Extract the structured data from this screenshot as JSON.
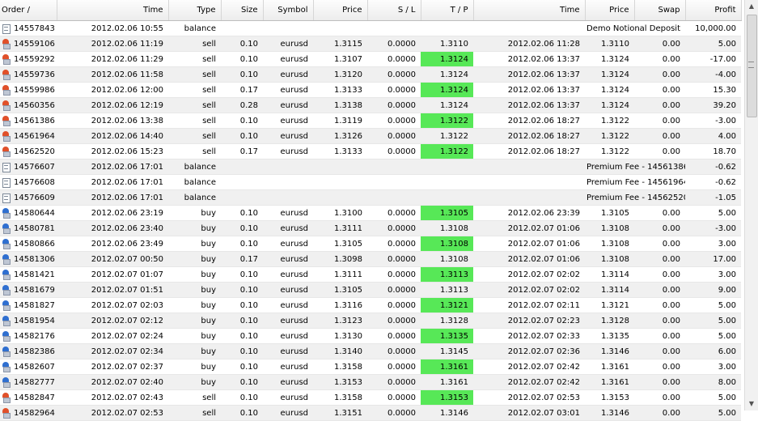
{
  "columns": [
    {
      "key": "order",
      "label": "Order  /",
      "align": "l",
      "w": 70
    },
    {
      "key": "time",
      "label": "Time",
      "align": "r",
      "w": 138
    },
    {
      "key": "type",
      "label": "Type",
      "align": "r",
      "w": 65
    },
    {
      "key": "size",
      "label": "Size",
      "align": "r",
      "w": 52
    },
    {
      "key": "symbol",
      "label": "Symbol",
      "align": "r",
      "w": 62
    },
    {
      "key": "price",
      "label": "Price",
      "align": "r",
      "w": 67
    },
    {
      "key": "sl",
      "label": "S / L",
      "align": "r",
      "w": 66
    },
    {
      "key": "tp",
      "label": "T / P",
      "align": "r",
      "w": 65
    },
    {
      "key": "ctime",
      "label": "Time",
      "align": "r",
      "w": 138
    },
    {
      "key": "cprice",
      "label": "Price",
      "align": "r",
      "w": 61
    },
    {
      "key": "swap",
      "label": "Swap",
      "align": "r",
      "w": 63
    },
    {
      "key": "profit",
      "label": "Profit",
      "align": "r",
      "w": 69
    }
  ],
  "rows": [
    {
      "icon": "balance",
      "order": "14557843",
      "time": "2012.02.06 10:55",
      "type": "balance",
      "note": "Demo Notional Deposit",
      "profit": "10,000.00"
    },
    {
      "icon": "sell",
      "order": "14559106",
      "time": "2012.02.06 11:19",
      "type": "sell",
      "size": "0.10",
      "symbol": "eurusd",
      "price": "1.3115",
      "sl": "0.0000",
      "tp": "1.3110",
      "ctime": "2012.02.06 11:28",
      "cprice": "1.3110",
      "swap": "0.00",
      "profit": "5.00"
    },
    {
      "icon": "sell",
      "order": "14559292",
      "time": "2012.02.06 11:29",
      "type": "sell",
      "size": "0.10",
      "symbol": "eurusd",
      "price": "1.3107",
      "sl": "0.0000",
      "tp": "1.3124",
      "ctime": "2012.02.06 13:37",
      "cprice": "1.3124",
      "swap": "0.00",
      "profit": "-17.00"
    },
    {
      "icon": "sell",
      "order": "14559736",
      "time": "2012.02.06 11:58",
      "type": "sell",
      "size": "0.10",
      "symbol": "eurusd",
      "price": "1.3120",
      "sl": "0.0000",
      "tp": "1.3124",
      "ctime": "2012.02.06 13:37",
      "cprice": "1.3124",
      "swap": "0.00",
      "profit": "-4.00"
    },
    {
      "icon": "sell",
      "order": "14559986",
      "time": "2012.02.06 12:00",
      "type": "sell",
      "size": "0.17",
      "symbol": "eurusd",
      "price": "1.3133",
      "sl": "0.0000",
      "tp": "1.3124",
      "ctime": "2012.02.06 13:37",
      "cprice": "1.3124",
      "swap": "0.00",
      "profit": "15.30"
    },
    {
      "icon": "sell",
      "order": "14560356",
      "time": "2012.02.06 12:19",
      "type": "sell",
      "size": "0.28",
      "symbol": "eurusd",
      "price": "1.3138",
      "sl": "0.0000",
      "tp": "1.3124",
      "ctime": "2012.02.06 13:37",
      "cprice": "1.3124",
      "swap": "0.00",
      "profit": "39.20"
    },
    {
      "icon": "sell",
      "order": "14561386",
      "time": "2012.02.06 13:38",
      "type": "sell",
      "size": "0.10",
      "symbol": "eurusd",
      "price": "1.3119",
      "sl": "0.0000",
      "tp": "1.3122",
      "ctime": "2012.02.06 18:27",
      "cprice": "1.3122",
      "swap": "0.00",
      "profit": "-3.00"
    },
    {
      "icon": "sell",
      "order": "14561964",
      "time": "2012.02.06 14:40",
      "type": "sell",
      "size": "0.10",
      "symbol": "eurusd",
      "price": "1.3126",
      "sl": "0.0000",
      "tp": "1.3122",
      "ctime": "2012.02.06 18:27",
      "cprice": "1.3122",
      "swap": "0.00",
      "profit": "4.00"
    },
    {
      "icon": "sell",
      "order": "14562520",
      "time": "2012.02.06 15:23",
      "type": "sell",
      "size": "0.17",
      "symbol": "eurusd",
      "price": "1.3133",
      "sl": "0.0000",
      "tp": "1.3122",
      "ctime": "2012.02.06 18:27",
      "cprice": "1.3122",
      "swap": "0.00",
      "profit": "18.70"
    },
    {
      "icon": "balance",
      "order": "14576607",
      "time": "2012.02.06 17:01",
      "type": "balance",
      "note": "Premium Fee - 14561386",
      "profit": "-0.62"
    },
    {
      "icon": "balance",
      "order": "14576608",
      "time": "2012.02.06 17:01",
      "type": "balance",
      "note": "Premium Fee - 14561964",
      "profit": "-0.62"
    },
    {
      "icon": "balance",
      "order": "14576609",
      "time": "2012.02.06 17:01",
      "type": "balance",
      "note": "Premium Fee - 14562520",
      "profit": "-1.05"
    },
    {
      "icon": "buy",
      "order": "14580644",
      "time": "2012.02.06 23:19",
      "type": "buy",
      "size": "0.10",
      "symbol": "eurusd",
      "price": "1.3100",
      "sl": "0.0000",
      "tp": "1.3105",
      "ctime": "2012.02.06 23:39",
      "cprice": "1.3105",
      "swap": "0.00",
      "profit": "5.00"
    },
    {
      "icon": "buy",
      "order": "14580781",
      "time": "2012.02.06 23:40",
      "type": "buy",
      "size": "0.10",
      "symbol": "eurusd",
      "price": "1.3111",
      "sl": "0.0000",
      "tp": "1.3108",
      "ctime": "2012.02.07 01:06",
      "cprice": "1.3108",
      "swap": "0.00",
      "profit": "-3.00"
    },
    {
      "icon": "buy",
      "order": "14580866",
      "time": "2012.02.06 23:49",
      "type": "buy",
      "size": "0.10",
      "symbol": "eurusd",
      "price": "1.3105",
      "sl": "0.0000",
      "tp": "1.3108",
      "ctime": "2012.02.07 01:06",
      "cprice": "1.3108",
      "swap": "0.00",
      "profit": "3.00"
    },
    {
      "icon": "buy",
      "order": "14581306",
      "time": "2012.02.07 00:50",
      "type": "buy",
      "size": "0.17",
      "symbol": "eurusd",
      "price": "1.3098",
      "sl": "0.0000",
      "tp": "1.3108",
      "ctime": "2012.02.07 01:06",
      "cprice": "1.3108",
      "swap": "0.00",
      "profit": "17.00"
    },
    {
      "icon": "buy",
      "order": "14581421",
      "time": "2012.02.07 01:07",
      "type": "buy",
      "size": "0.10",
      "symbol": "eurusd",
      "price": "1.3111",
      "sl": "0.0000",
      "tp": "1.3113",
      "ctime": "2012.02.07 02:02",
      "cprice": "1.3114",
      "swap": "0.00",
      "profit": "3.00"
    },
    {
      "icon": "buy",
      "order": "14581679",
      "time": "2012.02.07 01:51",
      "type": "buy",
      "size": "0.10",
      "symbol": "eurusd",
      "price": "1.3105",
      "sl": "0.0000",
      "tp": "1.3113",
      "ctime": "2012.02.07 02:02",
      "cprice": "1.3114",
      "swap": "0.00",
      "profit": "9.00"
    },
    {
      "icon": "buy",
      "order": "14581827",
      "time": "2012.02.07 02:03",
      "type": "buy",
      "size": "0.10",
      "symbol": "eurusd",
      "price": "1.3116",
      "sl": "0.0000",
      "tp": "1.3121",
      "ctime": "2012.02.07 02:11",
      "cprice": "1.3121",
      "swap": "0.00",
      "profit": "5.00"
    },
    {
      "icon": "buy",
      "order": "14581954",
      "time": "2012.02.07 02:12",
      "type": "buy",
      "size": "0.10",
      "symbol": "eurusd",
      "price": "1.3123",
      "sl": "0.0000",
      "tp": "1.3128",
      "ctime": "2012.02.07 02:23",
      "cprice": "1.3128",
      "swap": "0.00",
      "profit": "5.00"
    },
    {
      "icon": "buy",
      "order": "14582176",
      "time": "2012.02.07 02:24",
      "type": "buy",
      "size": "0.10",
      "symbol": "eurusd",
      "price": "1.3130",
      "sl": "0.0000",
      "tp": "1.3135",
      "ctime": "2012.02.07 02:33",
      "cprice": "1.3135",
      "swap": "0.00",
      "profit": "5.00"
    },
    {
      "icon": "buy",
      "order": "14582386",
      "time": "2012.02.07 02:34",
      "type": "buy",
      "size": "0.10",
      "symbol": "eurusd",
      "price": "1.3140",
      "sl": "0.0000",
      "tp": "1.3145",
      "ctime": "2012.02.07 02:36",
      "cprice": "1.3146",
      "swap": "0.00",
      "profit": "6.00"
    },
    {
      "icon": "buy",
      "order": "14582607",
      "time": "2012.02.07 02:37",
      "type": "buy",
      "size": "0.10",
      "symbol": "eurusd",
      "price": "1.3158",
      "sl": "0.0000",
      "tp": "1.3161",
      "ctime": "2012.02.07 02:42",
      "cprice": "1.3161",
      "swap": "0.00",
      "profit": "3.00"
    },
    {
      "icon": "buy",
      "order": "14582777",
      "time": "2012.02.07 02:40",
      "type": "buy",
      "size": "0.10",
      "symbol": "eurusd",
      "price": "1.3153",
      "sl": "0.0000",
      "tp": "1.3161",
      "ctime": "2012.02.07 02:42",
      "cprice": "1.3161",
      "swap": "0.00",
      "profit": "8.00"
    },
    {
      "icon": "sell",
      "order": "14582847",
      "time": "2012.02.07 02:43",
      "type": "sell",
      "size": "0.10",
      "symbol": "eurusd",
      "price": "1.3158",
      "sl": "0.0000",
      "tp": "1.3153",
      "ctime": "2012.02.07 02:53",
      "cprice": "1.3153",
      "swap": "0.00",
      "profit": "5.00"
    },
    {
      "icon": "sell",
      "order": "14582964",
      "time": "2012.02.07 02:53",
      "type": "sell",
      "size": "0.10",
      "symbol": "eurusd",
      "price": "1.3151",
      "sl": "0.0000",
      "tp": "1.3146",
      "ctime": "2012.02.07 03:01",
      "cprice": "1.3146",
      "swap": "0.00",
      "profit": "5.00"
    }
  ],
  "colors": {
    "tp_highlight": "#57e857",
    "alt_row": "#f0f0f0"
  },
  "scrollbar": {
    "up_icon": "scroll-up-arrow",
    "down_icon": "scroll-down-arrow"
  }
}
